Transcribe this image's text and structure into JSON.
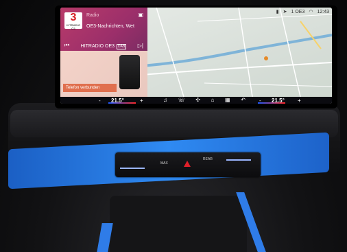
{
  "status_bar": {
    "signal_label": "1 OE3",
    "time": "12:43"
  },
  "media": {
    "source_label": "Radio",
    "program_text": "OE3-Nachrichten, Wet",
    "station_name": "HITRADIO OE3",
    "dab_label": "DAB",
    "logo_number": "3",
    "logo_text": "HITRADIO Ö3",
    "phone_status": "Telefon verbunden"
  },
  "climate": {
    "left_temp": "21.5°",
    "right_temp": "21.5°",
    "left_minus": "-",
    "left_plus": "+",
    "right_minus": "-",
    "right_plus": "+"
  },
  "dock": {
    "items": [
      "music-icon",
      "phone-icon",
      "fan-icon",
      "home-icon",
      "apps-icon",
      "back-icon"
    ]
  },
  "physical_controls": {
    "defrost_rear_label": "MAX",
    "defrost_front_label": "REAR"
  },
  "colors": {
    "media_accent": "#b93b6a",
    "ambient_light": "#2f8af2",
    "hazard": "#e0202a"
  }
}
